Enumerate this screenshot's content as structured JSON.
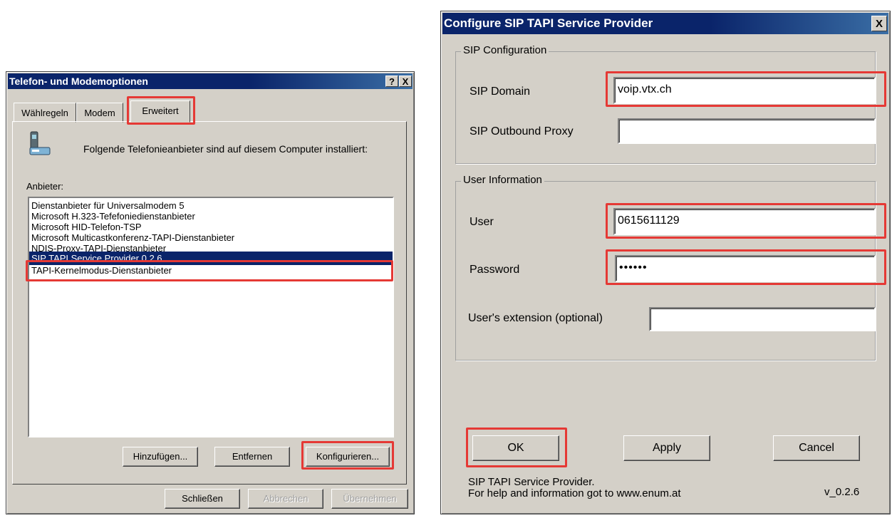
{
  "left_dialog": {
    "title": "Telefon- und Modemoptionen",
    "help_button": "?",
    "close_button": "X",
    "tabs": [
      "Wählregeln",
      "Modem",
      "Erweitert"
    ],
    "description": "Folgende Telefonieanbieter sind auf diesem Computer installiert:",
    "providers_label": "Anbieter:",
    "providers": [
      "Dienstanbieter für Universalmodem 5",
      "Microsoft H.323-Tefefoniedienstanbieter",
      "Microsoft HID-Telefon-TSP",
      "Microsoft Multicastkonferenz-TAPI-Dienstanbieter",
      "NDIS-Proxy-TAPI-Dienstanbieter",
      "SIP TAPI Service Provider 0.2.6",
      "TAPI-Kernelmodus-Dienstanbieter"
    ],
    "selected_provider": "SIP TAPI Service Provider 0.2.6",
    "buttons": {
      "add": "Hinzufügen...",
      "remove": "Entfernen",
      "configure": "Konfigurieren..."
    },
    "footer_buttons": {
      "close": "Schließen",
      "cancel": "Abbrechen",
      "apply": "Übernehmen"
    }
  },
  "right_dialog": {
    "title": "Configure SIP TAPI Service Provider",
    "close_button": "X",
    "sip_group": {
      "title": "SIP Configuration",
      "domain_label": "SIP Domain",
      "domain_value": "voip.vtx.ch",
      "proxy_label": "SIP Outbound Proxy",
      "proxy_value": ""
    },
    "user_group": {
      "title": "User Information",
      "user_label": "User",
      "user_value": "0615611129",
      "password_label": "Password",
      "password_value": "••••••",
      "extension_label": "User's extension (optional)",
      "extension_value": ""
    },
    "buttons": {
      "ok": "OK",
      "apply": "Apply",
      "cancel": "Cancel"
    },
    "footer_line1": "SIP TAPI Service Provider.",
    "footer_line2": "For help and information got to www.enum.at",
    "version": "v_0.2.6"
  },
  "colors": {
    "highlight": "#e53935",
    "titlebar": "#0a246a",
    "dialog_bg": "#d4d0c8",
    "selection": "#0a246a"
  }
}
